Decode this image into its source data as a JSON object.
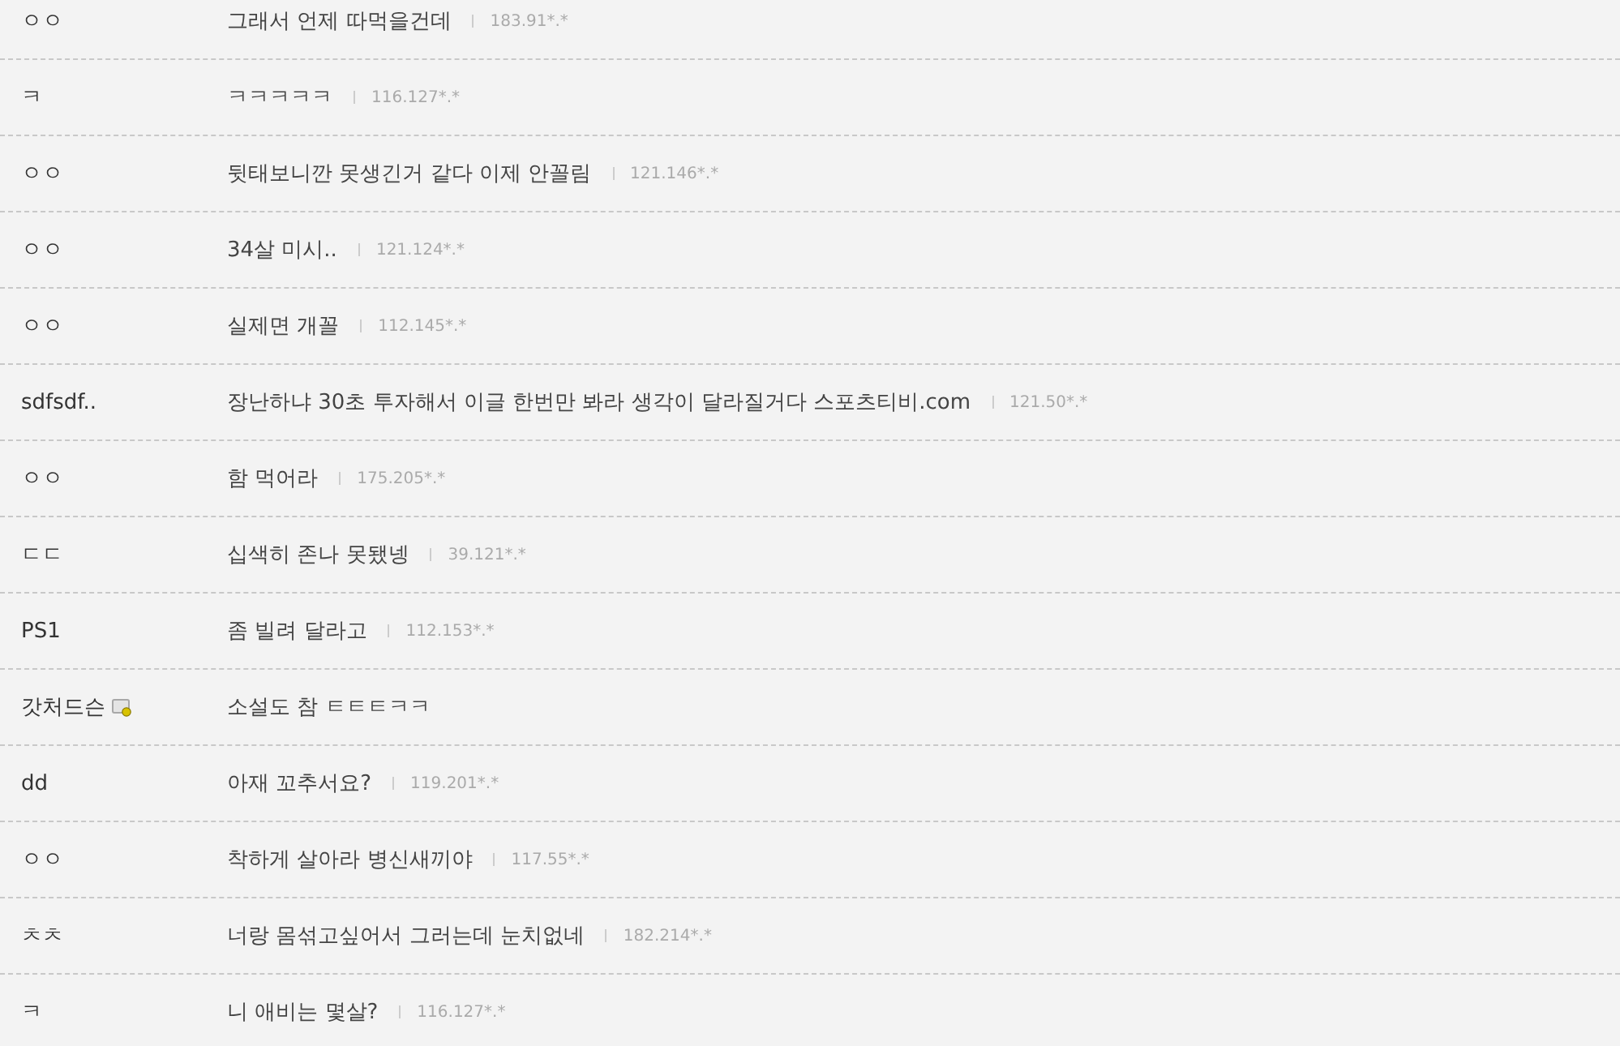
{
  "comments": [
    {
      "name": "ㅇㅇ",
      "member_icon": false,
      "text": "그래서 언제 따먹을건데",
      "ip": "183.91*.*"
    },
    {
      "name": "ㅋ",
      "member_icon": false,
      "text": "ㅋㅋㅋㅋㅋ",
      "ip": "116.127*.*"
    },
    {
      "name": "ㅇㅇ",
      "member_icon": false,
      "text": "뒷태보니깐 못생긴거 같다 이제 안꼴림",
      "ip": "121.146*.*"
    },
    {
      "name": "ㅇㅇ",
      "member_icon": false,
      "text": "34살 미시..",
      "ip": "121.124*.*"
    },
    {
      "name": "ㅇㅇ",
      "member_icon": false,
      "text": "실제면 개꼴",
      "ip": "112.145*.*"
    },
    {
      "name": "sdfsdf..",
      "member_icon": false,
      "text": "장난하냐 30초 투자해서 이글 한번만 봐라 생각이 달라질거다 스포츠티비.com",
      "ip": "121.50*.*"
    },
    {
      "name": "ㅇㅇ",
      "member_icon": false,
      "text": "함 먹어라",
      "ip": "175.205*.*"
    },
    {
      "name": "ㄷㄷ",
      "member_icon": false,
      "text": "십색히 존나 못됐넹",
      "ip": "39.121*.*"
    },
    {
      "name": "PS1",
      "member_icon": false,
      "text": "좀 빌려 달라고",
      "ip": "112.153*.*"
    },
    {
      "name": "갓처드슨",
      "member_icon": true,
      "text": "소설도 참 ㅌㅌㅌㅋㅋ"
    },
    {
      "name": "dd",
      "member_icon": false,
      "text": "아재 꼬추서요?",
      "ip": "119.201*.*"
    },
    {
      "name": "ㅇㅇ",
      "member_icon": false,
      "text": "착하게 살아라 병신새끼야",
      "ip": "117.55*.*"
    },
    {
      "name": "ㅊㅊ",
      "member_icon": false,
      "text": "너랑 몸섞고싶어서 그러는데 눈치없네",
      "ip": "182.214*.*"
    },
    {
      "name": "ㅋ",
      "member_icon": false,
      "text": "니 애비는 몇살?",
      "ip": "116.127*.*"
    }
  ]
}
